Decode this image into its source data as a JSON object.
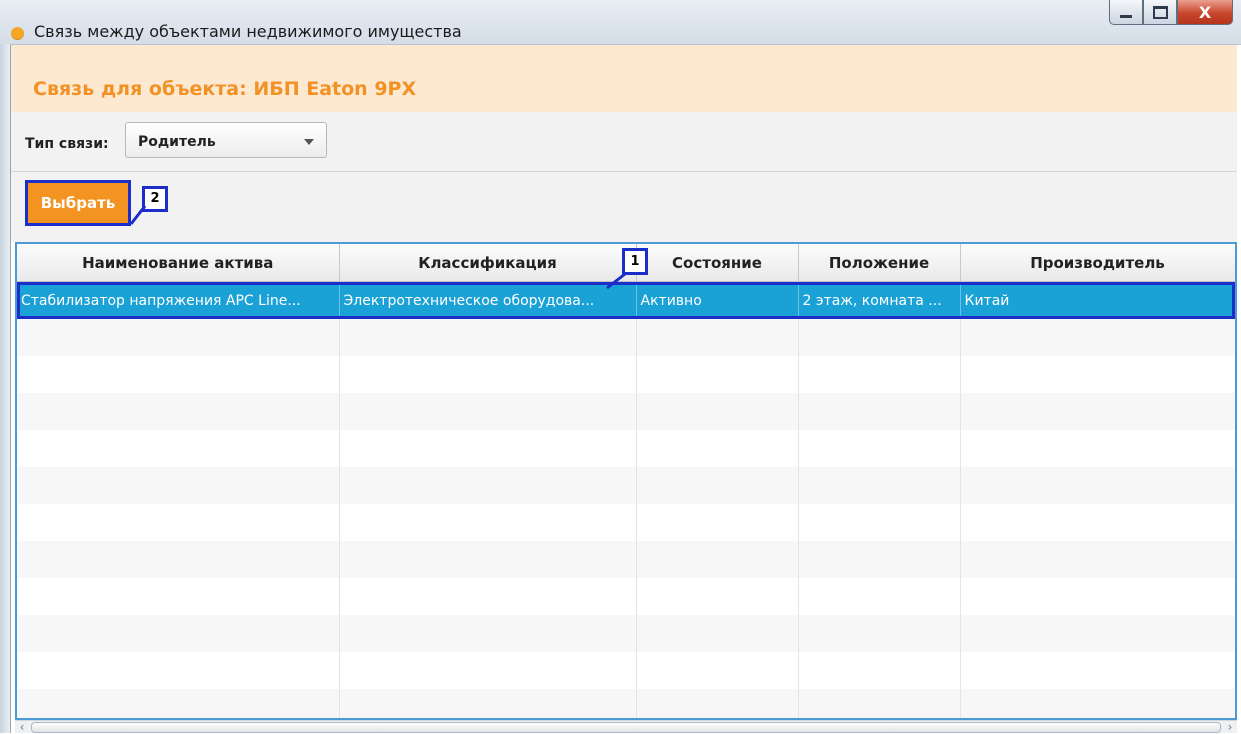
{
  "window": {
    "title": "Связь между объектами недвижимого имущества",
    "close_glyph": "X"
  },
  "header": {
    "title": "Связь для объекта: ИБП Eaton 9PX"
  },
  "toolbar": {
    "link_type_label": "Тип связи:",
    "link_type_value": "Родитель"
  },
  "actions": {
    "select_label": "Выбрать",
    "select_callout": "2"
  },
  "table": {
    "callout": "1",
    "columns": [
      "Наименование актива",
      "Классификация",
      "Состояние",
      "Положение",
      "Производитель"
    ],
    "rows": [
      [
        "Стабилизатор напряжения APC Line...",
        "Электротехническое оборудова...",
        "Активно",
        "2 этаж, комната ...",
        "Китай"
      ]
    ]
  },
  "colors": {
    "accent": "#f39322",
    "selection": "#1aa2d6",
    "callout_border": "#1b2ec9",
    "header_band": "#fde8d2"
  },
  "icons": {
    "window_icon": "orange-dot-icon",
    "minimize": "minimize-icon",
    "maximize": "maximize-icon",
    "close": "close-icon",
    "dropdown": "chevron-down-icon"
  }
}
